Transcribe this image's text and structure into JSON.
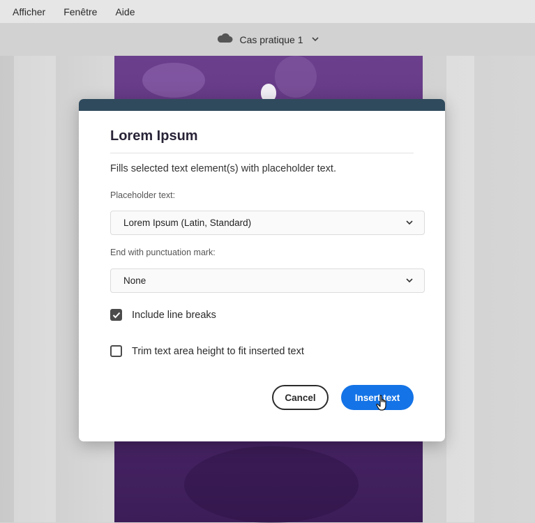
{
  "menu": {
    "items": [
      "Afficher",
      "Fenêtre",
      "Aide"
    ]
  },
  "titlebar": {
    "title": "Cas pratique 1",
    "cloud_icon": "cloud-icon",
    "chevron_icon": "chevron-down-icon"
  },
  "dialog": {
    "title": "Lorem Ipsum",
    "description": "Fills selected text element(s) with placeholder text.",
    "placeholder_label": "Placeholder text:",
    "placeholder_value": "Lorem Ipsum (Latin, Standard)",
    "punctuation_label": "End with punctuation mark:",
    "punctuation_value": "None",
    "checkboxes": [
      {
        "label": "Include line breaks",
        "checked": true
      },
      {
        "label": "Trim text area height to fit inserted text",
        "checked": false
      }
    ],
    "cancel_label": "Cancel",
    "insert_label": "Insert text",
    "accent_color": "#1473e6",
    "header_color": "#2f4a5c"
  }
}
